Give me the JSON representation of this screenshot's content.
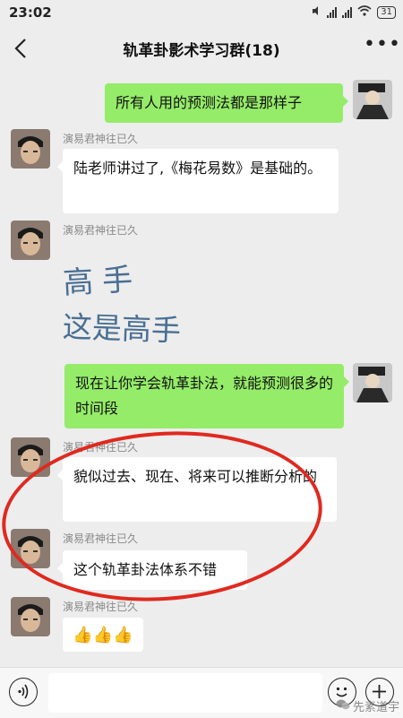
{
  "status": {
    "time": "23:02",
    "battery": "31"
  },
  "chat": {
    "title": "轨革卦影术学习群(18)"
  },
  "messages": [
    {
      "id": 1,
      "side": "out",
      "text": "所有人用的预测法都是那样子"
    },
    {
      "id": 2,
      "side": "in",
      "sender": "演易君神往已久",
      "text": "陆老师讲过了,《梅花易数》是基础的。"
    },
    {
      "id": 3,
      "side": "in",
      "sender": "演易君神往已久",
      "line1": "高手",
      "line2": "这是高手"
    },
    {
      "id": 4,
      "side": "out",
      "text": "现在让你学会轨革卦法，就能预测很多的时间段"
    },
    {
      "id": 5,
      "side": "in",
      "sender": "演易君神往已久",
      "text": "貌似过去、现在、将来可以推断分析的"
    },
    {
      "id": 6,
      "side": "in",
      "sender": "演易君神往已久",
      "text": "这个轨革卦法体系不错"
    },
    {
      "id": 7,
      "side": "in",
      "sender": "演易君神往已久",
      "emoji": "👍👍👍"
    }
  ],
  "watermark": "先素道宇",
  "colors": {
    "background": "#ededed",
    "outgoing_bubble": "#95ec69",
    "incoming_bubble": "#ffffff",
    "annotation_circle": "#e0291f",
    "calligraphy": "#4a6f94"
  },
  "icons": {
    "back": "chevron-left-icon",
    "more": "more-dots-icon",
    "voice": "voice-icon",
    "emoji": "emoji-icon",
    "plus": "plus-icon"
  }
}
